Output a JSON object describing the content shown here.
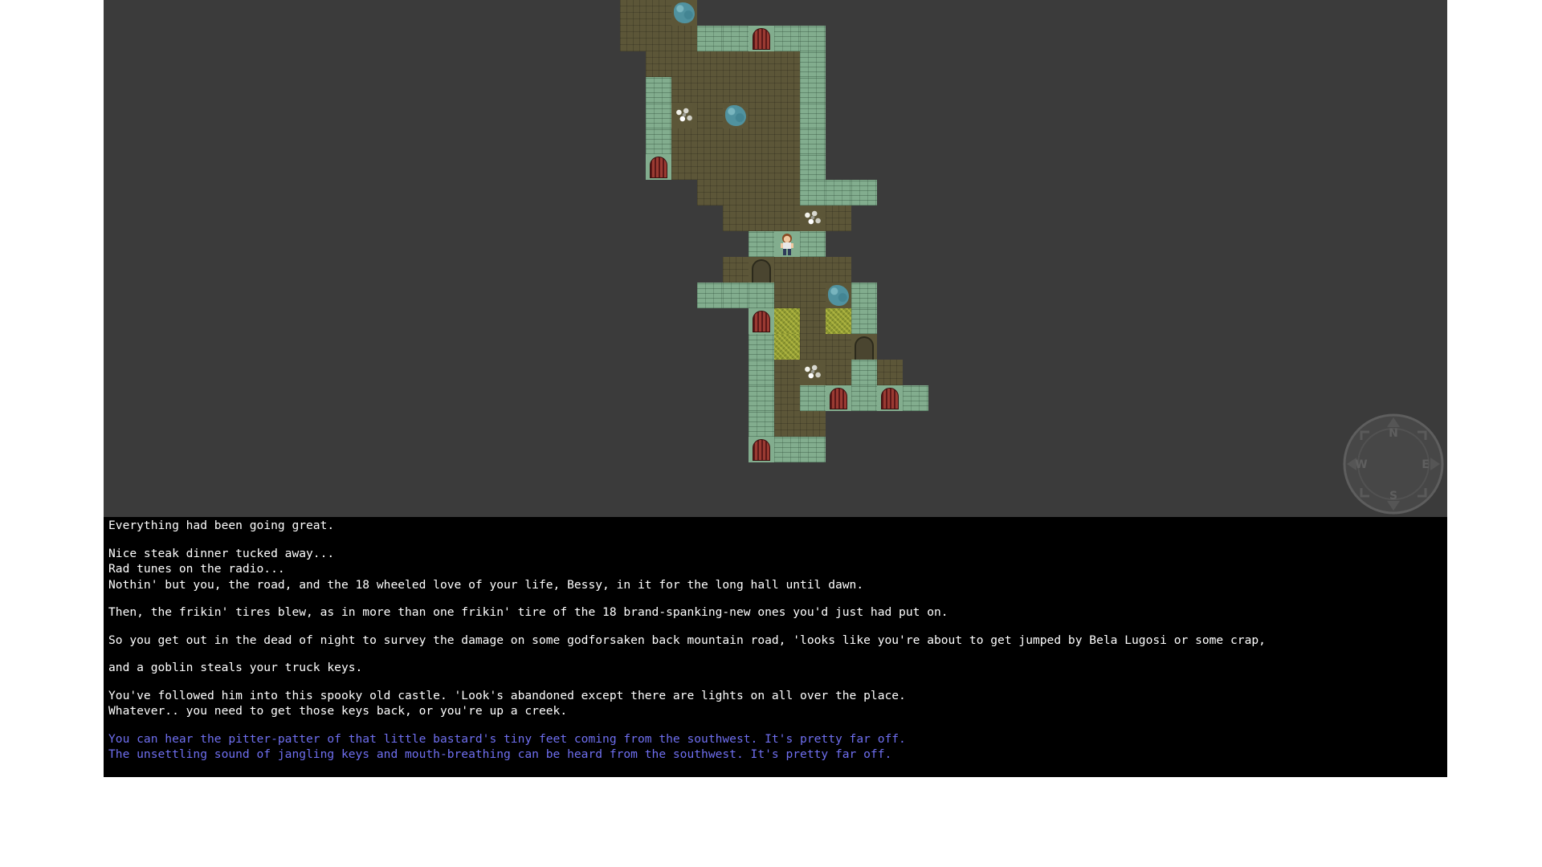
{
  "messages": [
    {
      "text": "Everything had been going great.",
      "kind": "narration"
    },
    {
      "text": "Nice steak dinner tucked away...",
      "kind": "narration"
    },
    {
      "text": "Rad tunes on the radio...",
      "kind": "narration"
    },
    {
      "text": "Nothin' but you, the road, and the 18 wheeled love of your life, Bessy, in it for the long hall until dawn.",
      "kind": "narration"
    },
    {
      "text": "Then, the frikin' tires blew, as in more than one frikin' tire of the 18 brand-spanking-new ones you'd just had put on.",
      "kind": "narration"
    },
    {
      "text": "So you get out in the dead of night to survey the damage on some godforsaken back mountain road, 'looks like you're about to get jumped by Bela Lugosi or some crap,",
      "kind": "narration"
    },
    {
      "text": "and a goblin steals your truck keys.",
      "kind": "narration"
    },
    {
      "text": "You've followed him into this spooky old castle. 'Look's abandoned except there are lights on all over the place.",
      "kind": "narration"
    },
    {
      "text": "Whatever.. you need to get those keys back, or you're up a creek.",
      "kind": "narration"
    },
    {
      "text": "You can hear the pitter-patter of that little bastard's tiny feet coming from the southwest. It's pretty far off.",
      "kind": "sound"
    },
    {
      "text": "The unsettling sound of jangling keys and mouth-breathing can be heard from the southwest. It's pretty far off.",
      "kind": "sound"
    }
  ],
  "compass": {
    "north": "N",
    "south": "S",
    "east": "E",
    "west": "W"
  },
  "colors": {
    "map_background": "#3b3b3b",
    "floor": "#5c5638",
    "wall": "#82ad8e",
    "log_background": "#000000",
    "narration_text": "#ffffff",
    "sound_text": "#6f6ff0"
  },
  "map_tiles": [
    {
      "type": "floor",
      "col": 0,
      "row": 0
    },
    {
      "type": "floor",
      "col": 1,
      "row": 0
    },
    {
      "type": "water",
      "col": 2,
      "row": 0
    },
    {
      "type": "floor",
      "col": 0,
      "row": 1
    },
    {
      "type": "floor",
      "col": 1,
      "row": 1
    },
    {
      "type": "floor",
      "col": 2,
      "row": 1
    },
    {
      "type": "wall",
      "col": 3,
      "row": 1
    },
    {
      "type": "wall",
      "col": 4,
      "row": 1
    },
    {
      "type": "door",
      "col": 5,
      "row": 1
    },
    {
      "type": "wall",
      "col": 6,
      "row": 1
    },
    {
      "type": "wall",
      "col": 7,
      "row": 1
    },
    {
      "type": "floor",
      "col": 1,
      "row": 2
    },
    {
      "type": "floor",
      "col": 2,
      "row": 2
    },
    {
      "type": "floor",
      "col": 3,
      "row": 2
    },
    {
      "type": "floor",
      "col": 4,
      "row": 2
    },
    {
      "type": "floor",
      "col": 5,
      "row": 2
    },
    {
      "type": "floor",
      "col": 6,
      "row": 2
    },
    {
      "type": "wall",
      "col": 7,
      "row": 2
    },
    {
      "type": "wall",
      "col": 1,
      "row": 3
    },
    {
      "type": "floor",
      "col": 2,
      "row": 3
    },
    {
      "type": "floor",
      "col": 3,
      "row": 3
    },
    {
      "type": "floor",
      "col": 4,
      "row": 3
    },
    {
      "type": "floor",
      "col": 5,
      "row": 3
    },
    {
      "type": "floor",
      "col": 6,
      "row": 3
    },
    {
      "type": "wall",
      "col": 7,
      "row": 3
    },
    {
      "type": "wall",
      "col": 1,
      "row": 4
    },
    {
      "type": "bones",
      "col": 2,
      "row": 4
    },
    {
      "type": "floor",
      "col": 3,
      "row": 4
    },
    {
      "type": "water",
      "col": 4,
      "row": 4
    },
    {
      "type": "floor",
      "col": 5,
      "row": 4
    },
    {
      "type": "floor",
      "col": 6,
      "row": 4
    },
    {
      "type": "wall",
      "col": 7,
      "row": 4
    },
    {
      "type": "wall",
      "col": 1,
      "row": 5
    },
    {
      "type": "floor",
      "col": 2,
      "row": 5
    },
    {
      "type": "floor",
      "col": 3,
      "row": 5
    },
    {
      "type": "floor",
      "col": 4,
      "row": 5
    },
    {
      "type": "floor",
      "col": 5,
      "row": 5
    },
    {
      "type": "floor",
      "col": 6,
      "row": 5
    },
    {
      "type": "wall",
      "col": 7,
      "row": 5
    },
    {
      "type": "door",
      "col": 1,
      "row": 6
    },
    {
      "type": "floor",
      "col": 2,
      "row": 6
    },
    {
      "type": "floor",
      "col": 3,
      "row": 6
    },
    {
      "type": "floor",
      "col": 4,
      "row": 6
    },
    {
      "type": "floor",
      "col": 5,
      "row": 6
    },
    {
      "type": "floor",
      "col": 6,
      "row": 6
    },
    {
      "type": "wall",
      "col": 7,
      "row": 6
    },
    {
      "type": "floor",
      "col": 3,
      "row": 7
    },
    {
      "type": "floor",
      "col": 4,
      "row": 7
    },
    {
      "type": "floor",
      "col": 5,
      "row": 7
    },
    {
      "type": "floor",
      "col": 6,
      "row": 7
    },
    {
      "type": "wall",
      "col": 7,
      "row": 7
    },
    {
      "type": "wall",
      "col": 8,
      "row": 7
    },
    {
      "type": "wall",
      "col": 9,
      "row": 7
    },
    {
      "type": "floor",
      "col": 4,
      "row": 8
    },
    {
      "type": "floor",
      "col": 5,
      "row": 8
    },
    {
      "type": "floor",
      "col": 6,
      "row": 8
    },
    {
      "type": "bones",
      "col": 7,
      "row": 8
    },
    {
      "type": "floor",
      "col": 8,
      "row": 8
    },
    {
      "type": "wall",
      "col": 5,
      "row": 9
    },
    {
      "type": "player",
      "col": 6,
      "row": 9
    },
    {
      "type": "wall",
      "col": 7,
      "row": 9
    },
    {
      "type": "floor",
      "col": 4,
      "row": 10
    },
    {
      "type": "arch",
      "col": 5,
      "row": 10
    },
    {
      "type": "floor",
      "col": 6,
      "row": 10
    },
    {
      "type": "floor",
      "col": 7,
      "row": 10
    },
    {
      "type": "floor",
      "col": 8,
      "row": 10
    },
    {
      "type": "wall",
      "col": 3,
      "row": 11
    },
    {
      "type": "wall",
      "col": 4,
      "row": 11
    },
    {
      "type": "wall",
      "col": 5,
      "row": 11
    },
    {
      "type": "floor",
      "col": 6,
      "row": 11
    },
    {
      "type": "floor",
      "col": 7,
      "row": 11
    },
    {
      "type": "water",
      "col": 8,
      "row": 11
    },
    {
      "type": "wall",
      "col": 9,
      "row": 11
    },
    {
      "type": "door",
      "col": 5,
      "row": 12
    },
    {
      "type": "moss",
      "col": 6,
      "row": 12
    },
    {
      "type": "floor",
      "col": 7,
      "row": 12
    },
    {
      "type": "moss",
      "col": 8,
      "row": 12
    },
    {
      "type": "wall",
      "col": 9,
      "row": 12
    },
    {
      "type": "wall",
      "col": 5,
      "row": 13
    },
    {
      "type": "moss",
      "col": 6,
      "row": 13
    },
    {
      "type": "floor",
      "col": 7,
      "row": 13
    },
    {
      "type": "floor",
      "col": 8,
      "row": 13
    },
    {
      "type": "arch",
      "col": 9,
      "row": 13
    },
    {
      "type": "wall",
      "col": 5,
      "row": 14
    },
    {
      "type": "floor",
      "col": 6,
      "row": 14
    },
    {
      "type": "bones",
      "col": 7,
      "row": 14
    },
    {
      "type": "floor",
      "col": 8,
      "row": 14
    },
    {
      "type": "wall",
      "col": 9,
      "row": 14
    },
    {
      "type": "floor",
      "col": 10,
      "row": 14
    },
    {
      "type": "wall",
      "col": 5,
      "row": 15
    },
    {
      "type": "floor",
      "col": 6,
      "row": 15
    },
    {
      "type": "wall",
      "col": 7,
      "row": 15
    },
    {
      "type": "door",
      "col": 8,
      "row": 15
    },
    {
      "type": "wall",
      "col": 9,
      "row": 15
    },
    {
      "type": "door",
      "col": 10,
      "row": 15
    },
    {
      "type": "wall",
      "col": 11,
      "row": 15
    },
    {
      "type": "wall",
      "col": 5,
      "row": 16
    },
    {
      "type": "floor",
      "col": 6,
      "row": 16
    },
    {
      "type": "floor",
      "col": 7,
      "row": 16
    },
    {
      "type": "door",
      "col": 5,
      "row": 17
    },
    {
      "type": "wall",
      "col": 6,
      "row": 17
    },
    {
      "type": "wall",
      "col": 7,
      "row": 17
    }
  ]
}
